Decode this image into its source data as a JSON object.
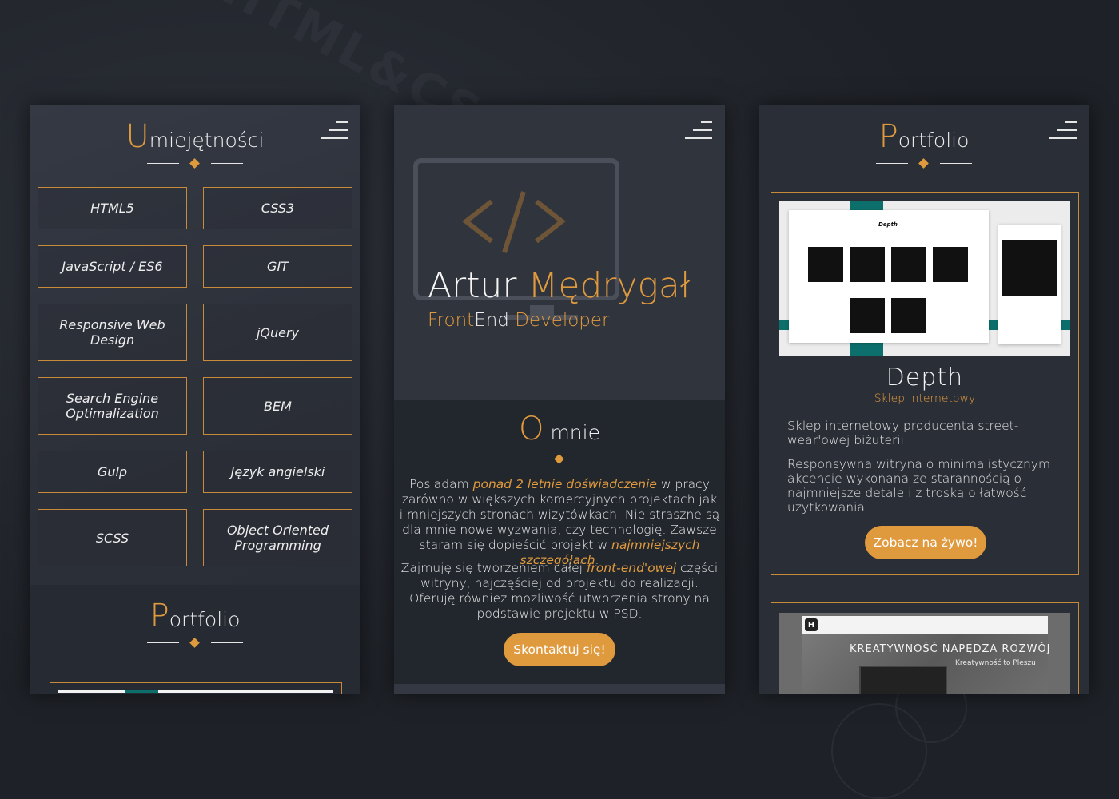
{
  "background": {
    "deco_text": "HTML&CSS"
  },
  "colors": {
    "accent": "#e09a3e",
    "teal": "#0c6f6b",
    "panel": "#2a2e36"
  },
  "skills_panel": {
    "title_first": "U",
    "title_rest": "miejętności",
    "skills": [
      "HTML5",
      "CSS3",
      "JavaScript / ES6",
      "GIT",
      "Responsive Web Design",
      "jQuery",
      "Search Engine Optimalization",
      "BEM",
      "Gulp",
      "Język angielski",
      "SCSS",
      "Object Oriented Programming"
    ],
    "portfolio_first": "P",
    "portfolio_rest": "ortfolio"
  },
  "hero_panel": {
    "name_first": "Artur",
    "name_last": "Mędrygał",
    "role_a": "Front",
    "role_b": "End",
    "role_c": " Developer",
    "about_first": "O",
    "about_rest": " mnie",
    "p1_a": "Posiadam ",
    "p1_em1": "ponad 2 letnie doświadczenie",
    "p1_b": " w pracy zarówno w większych komercyjnych projektach jak i mniejszych stronach wizytówkach. Nie straszne są dla mnie nowe wyzwania, czy technologię. Zawsze staram się dopieścić projekt w ",
    "p1_em2": "najmniejszych szczegółach",
    "p1_c": ".",
    "p2_a": "Zajmuję się tworzeniem całej ",
    "p2_em": "front-end'owej",
    "p2_b": " części witryny, najczęściej od projektu do realizacji. Oferuję również możliwość utworzenia strony na podstawie projektu w PSD.",
    "contact_button": "Skontaktuj się!"
  },
  "portfolio_panel": {
    "title_first": "P",
    "title_rest": "ortfolio",
    "project1": {
      "title": "Depth",
      "subtitle": "Sklep internetowy",
      "desc1": "Sklep internetowy producenta street-wear'owej biżuterii.",
      "desc2": "Responsywna witryna o minimalistycznym akcencie wykonana ze starannością o najmniejsze detale i z troską o łatwość użytkowania.",
      "button": "Zobacz na żywo!",
      "screenshot_logo": "Depth"
    },
    "project2": {
      "headline": "KREATYWNOŚĆ NAPĘDZA ROZWÓJ",
      "subline": "Kreatywność to Pleszu",
      "logo_letter": "H"
    }
  }
}
